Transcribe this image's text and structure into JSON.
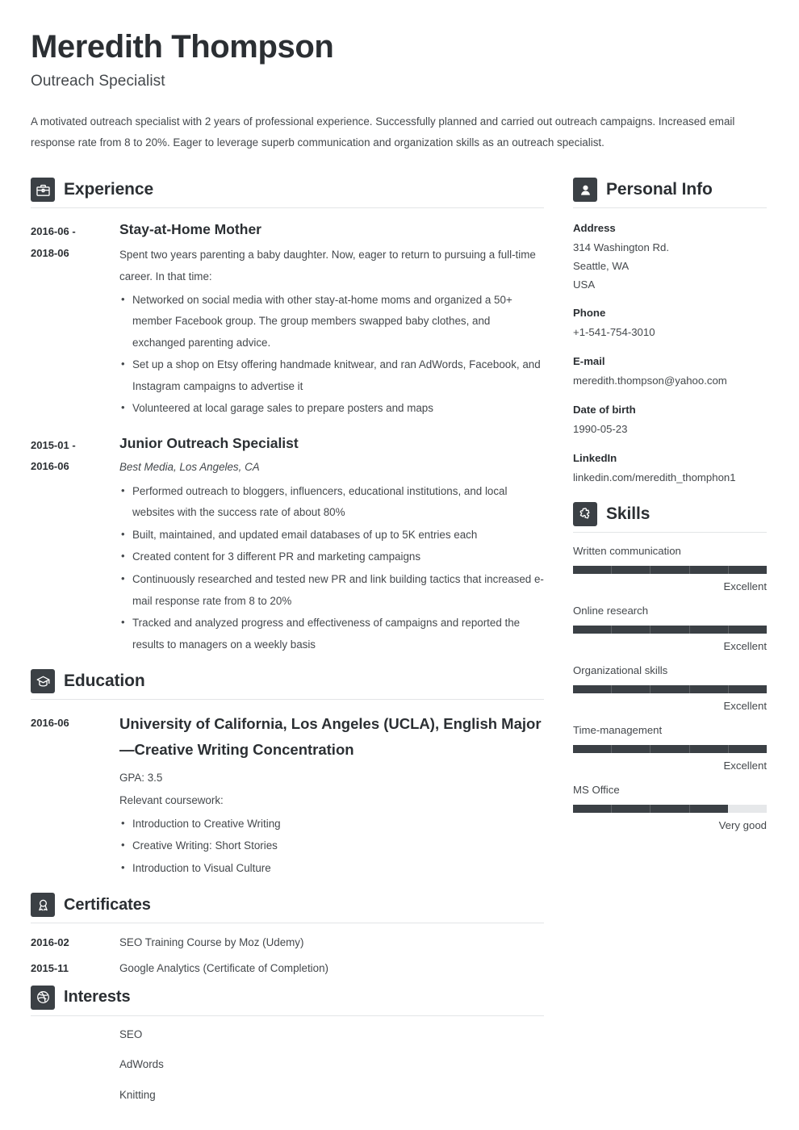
{
  "header": {
    "name": "Meredith Thompson",
    "title": "Outreach Specialist",
    "summary": "A motivated outreach specialist with 2 years of professional experience. Successfully planned and carried out outreach campaigns. Increased email response rate from 8 to 20%. Eager to leverage superb communication and organization skills as an outreach specialist."
  },
  "sections": {
    "experience": {
      "title": "Experience",
      "icon": "briefcase-icon",
      "entries": [
        {
          "date": "2016-06 - 2018-06",
          "title": "Stay-at-Home Mother",
          "subtitle": "",
          "description": "Spent two years parenting a baby daughter. Now, eager to return to pursuing a full-time career. In that time:",
          "bullets": [
            "Networked on social media with other stay-at-home moms and organized a 50+ member Facebook group. The group members swapped baby clothes, and exchanged parenting advice.",
            "Set up a shop on Etsy offering handmade knitwear, and ran AdWords, Facebook, and Instagram campaigns to advertise it",
            "Volunteered at local garage sales to prepare posters and maps"
          ]
        },
        {
          "date": "2015-01 - 2016-06",
          "title": "Junior Outreach Specialist",
          "subtitle": "Best Media, Los Angeles, CA",
          "description": "",
          "bullets": [
            "Performed outreach to bloggers, influencers, educational institutions, and local websites with the success rate of about 80%",
            "Built, maintained, and updated email databases of up to 5K entries each",
            "Created content for 3 different PR and marketing campaigns",
            "Continuously researched and tested new PR and link building tactics that increased e-mail response rate from 8 to 20%",
            "Tracked and analyzed progress and effectiveness of campaigns and reported the results to managers on a weekly basis"
          ]
        }
      ]
    },
    "education": {
      "title": "Education",
      "icon": "graduation-cap-icon",
      "entries": [
        {
          "date": "2016-06",
          "title": "University of California, Los Angeles (UCLA), English Major—Creative Writing Concentration",
          "gpa": "GPA: 3.5",
          "coursework_label": "Relevant coursework:",
          "bullets": [
            "Introduction to Creative Writing",
            "Creative Writing: Short Stories",
            "Introduction to Visual Culture"
          ]
        }
      ]
    },
    "certificates": {
      "title": "Certificates",
      "icon": "award-ribbon-icon",
      "entries": [
        {
          "date": "2016-02",
          "text": "SEO Training Course by Moz (Udemy)"
        },
        {
          "date": "2015-11",
          "text": "Google Analytics (Certificate of Completion)"
        }
      ]
    },
    "interests": {
      "title": "Interests",
      "icon": "dribbble-ball-icon",
      "entries": [
        {
          "text": "SEO"
        },
        {
          "text": "AdWords"
        },
        {
          "text": "Knitting"
        }
      ]
    },
    "personal_info": {
      "title": "Personal Info",
      "icon": "person-icon",
      "fields": [
        {
          "label": "Address",
          "lines": [
            "314 Washington Rd.",
            "Seattle, WA",
            "USA"
          ]
        },
        {
          "label": "Phone",
          "lines": [
            "+1-541-754-3010"
          ]
        },
        {
          "label": "E-mail",
          "lines": [
            "meredith.thompson@yahoo.com"
          ]
        },
        {
          "label": "Date of birth",
          "lines": [
            "1990-05-23"
          ]
        },
        {
          "label": "LinkedIn",
          "lines": [
            "linkedin.com/meredith_thomphon1"
          ]
        }
      ]
    },
    "skills": {
      "title": "Skills",
      "icon": "puzzle-piece-icon",
      "items": [
        {
          "name": "Written communication",
          "level": "Excellent",
          "percent": 100
        },
        {
          "name": "Online research",
          "level": "Excellent",
          "percent": 100
        },
        {
          "name": "Organizational skills",
          "level": "Excellent",
          "percent": 100
        },
        {
          "name": "Time-management",
          "level": "Excellent",
          "percent": 100
        },
        {
          "name": "MS Office",
          "level": "Very good",
          "percent": 80
        }
      ]
    }
  },
  "colors": {
    "icon_bg": "#3b4045",
    "heading": "#2b2f33",
    "body_text": "#44484c",
    "bar_filled": "#3b4045",
    "bar_empty": "#e6e8ea",
    "divider": "#e3e5e7"
  }
}
